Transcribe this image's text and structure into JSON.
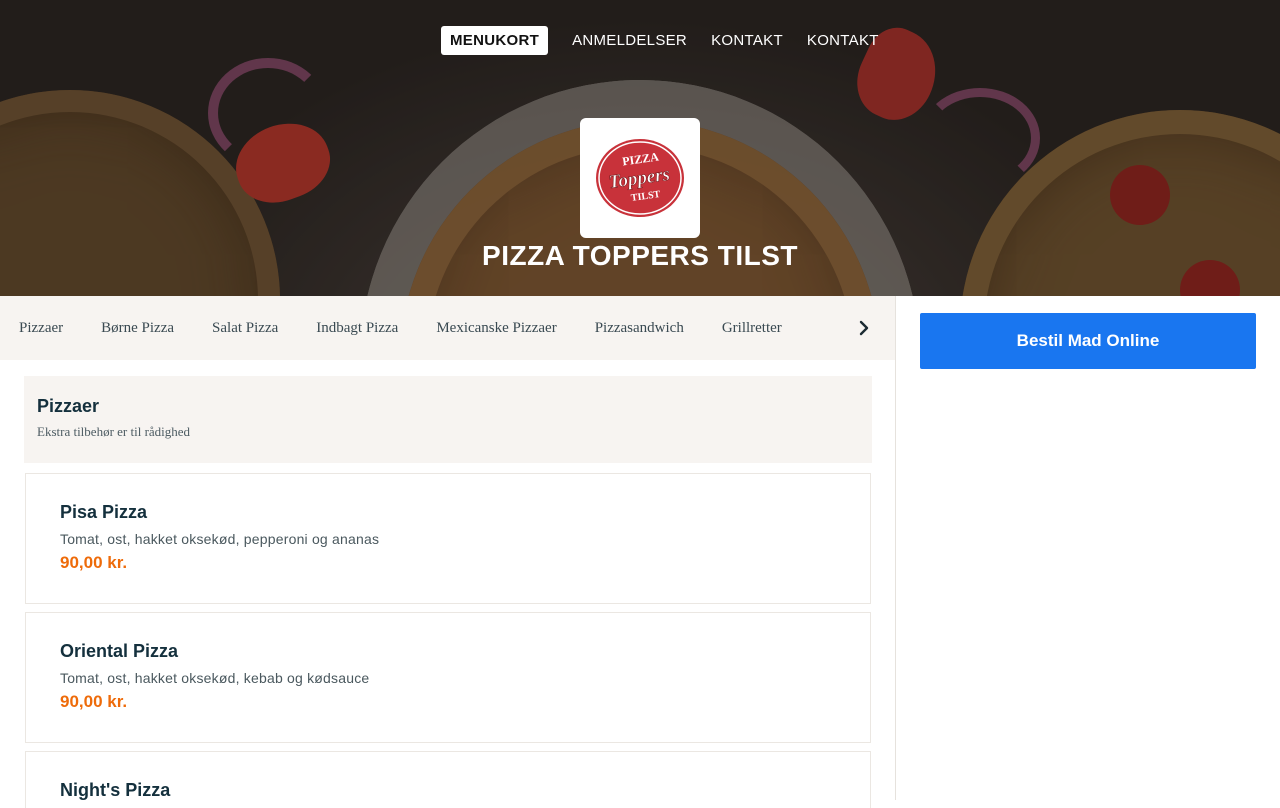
{
  "nav": {
    "items": [
      {
        "label": "MENUKORT",
        "active": true
      },
      {
        "label": "ANMELDELSER",
        "active": false
      },
      {
        "label": "KONTAKT",
        "active": false
      },
      {
        "label": "KONTAKT",
        "active": false
      }
    ]
  },
  "hero": {
    "title": "PIZZA TOPPERS TILST",
    "logo": {
      "top": "PIZZA",
      "middle": "Toppers",
      "bottom": "TILST"
    }
  },
  "categories": [
    "Pizzaer",
    "Børne Pizza",
    "Salat Pizza",
    "Indbagt Pizza",
    "Mexicanske Pizzaer",
    "Pizzasandwich",
    "Grillretter"
  ],
  "sidebar": {
    "order_button": "Bestil Mad Online"
  },
  "menu": {
    "section_title": "Pizzaer",
    "section_subtitle": "Ekstra tilbehør er til rådighed",
    "items": [
      {
        "name": "Pisa Pizza",
        "description": "Tomat, ost, hakket oksekød, pepperoni og ananas",
        "price": "90,00 kr."
      },
      {
        "name": "Oriental Pizza",
        "description": "Tomat, ost, hakket oksekød, kebab og kødsauce",
        "price": "90,00 kr."
      },
      {
        "name": "Night's Pizza",
        "description": "",
        "price": ""
      }
    ]
  },
  "colors": {
    "accent_blue": "#1976f0",
    "price_orange": "#ee6b0a",
    "logo_red": "#c8323a"
  }
}
